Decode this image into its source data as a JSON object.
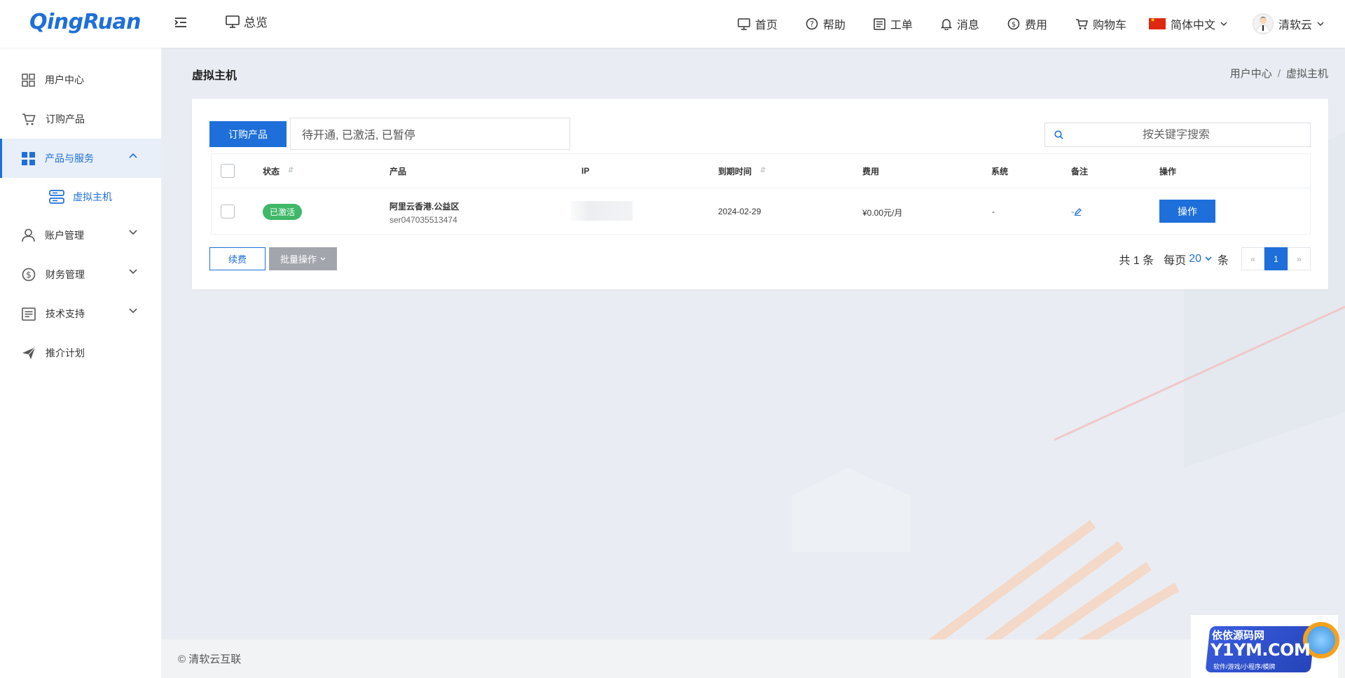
{
  "header": {
    "logo": "QingRuan",
    "overview_label": "总览",
    "nav": [
      {
        "label": "首页",
        "icon": "monitor-icon"
      },
      {
        "label": "帮助",
        "icon": "help-circle-icon"
      },
      {
        "label": "工单",
        "icon": "ticket-icon"
      },
      {
        "label": "消息",
        "icon": "bell-icon"
      },
      {
        "label": "费用",
        "icon": "dollar-icon"
      },
      {
        "label": "购物车",
        "icon": "cart-icon"
      }
    ],
    "language": "简体中文",
    "user_name": "清软云"
  },
  "sidebar": {
    "items": [
      {
        "label": "用户中心",
        "icon": "grid-icon"
      },
      {
        "label": "订购产品",
        "icon": "cart-icon"
      },
      {
        "label": "产品与服务",
        "icon": "apps-icon",
        "active": true,
        "expanded": true
      },
      {
        "label": "虚拟主机",
        "icon": "server-icon",
        "sub": true
      },
      {
        "label": "账户管理",
        "icon": "user-icon"
      },
      {
        "label": "财务管理",
        "icon": "dollar-icon"
      },
      {
        "label": "技术支持",
        "icon": "document-icon"
      },
      {
        "label": "推介计划",
        "icon": "send-icon"
      }
    ]
  },
  "page": {
    "title": "虚拟主机",
    "breadcrumb": [
      "用户中心",
      "虚拟主机"
    ]
  },
  "toolbar": {
    "order_label": "订购产品",
    "status_filter": "待开通, 已激活, 已暂停",
    "search_placeholder": "按关键字搜索"
  },
  "table": {
    "columns": [
      "状态",
      "产品",
      "IP",
      "到期时间",
      "费用",
      "系统",
      "备注",
      "操作"
    ],
    "rows": [
      {
        "status": "已激活",
        "product_name": "阿里云香港.公益区",
        "product_id": "ser047035513474",
        "ip": "",
        "expiry": "2024-02-29",
        "fee": "¥0.00元/月",
        "system": "-",
        "note": "-",
        "action": "操作"
      }
    ]
  },
  "footer_actions": {
    "renew_label": "续费",
    "batch_label": "批量操作"
  },
  "pagination": {
    "total_text": "共 1 条",
    "per_page_prefix": "每页",
    "per_page": "20",
    "per_page_suffix": "条",
    "prev": "«",
    "current": "1",
    "next": "»"
  },
  "footer": {
    "copyright": "© 清软云互联"
  },
  "watermark": {
    "line1": "依依源码网",
    "line2": "Y1YM.COM",
    "line3": "软件/游戏/小程序/模牌"
  },
  "colors": {
    "primary": "#1e6fd9",
    "success": "#3fb868",
    "background": "#e9edf3"
  }
}
